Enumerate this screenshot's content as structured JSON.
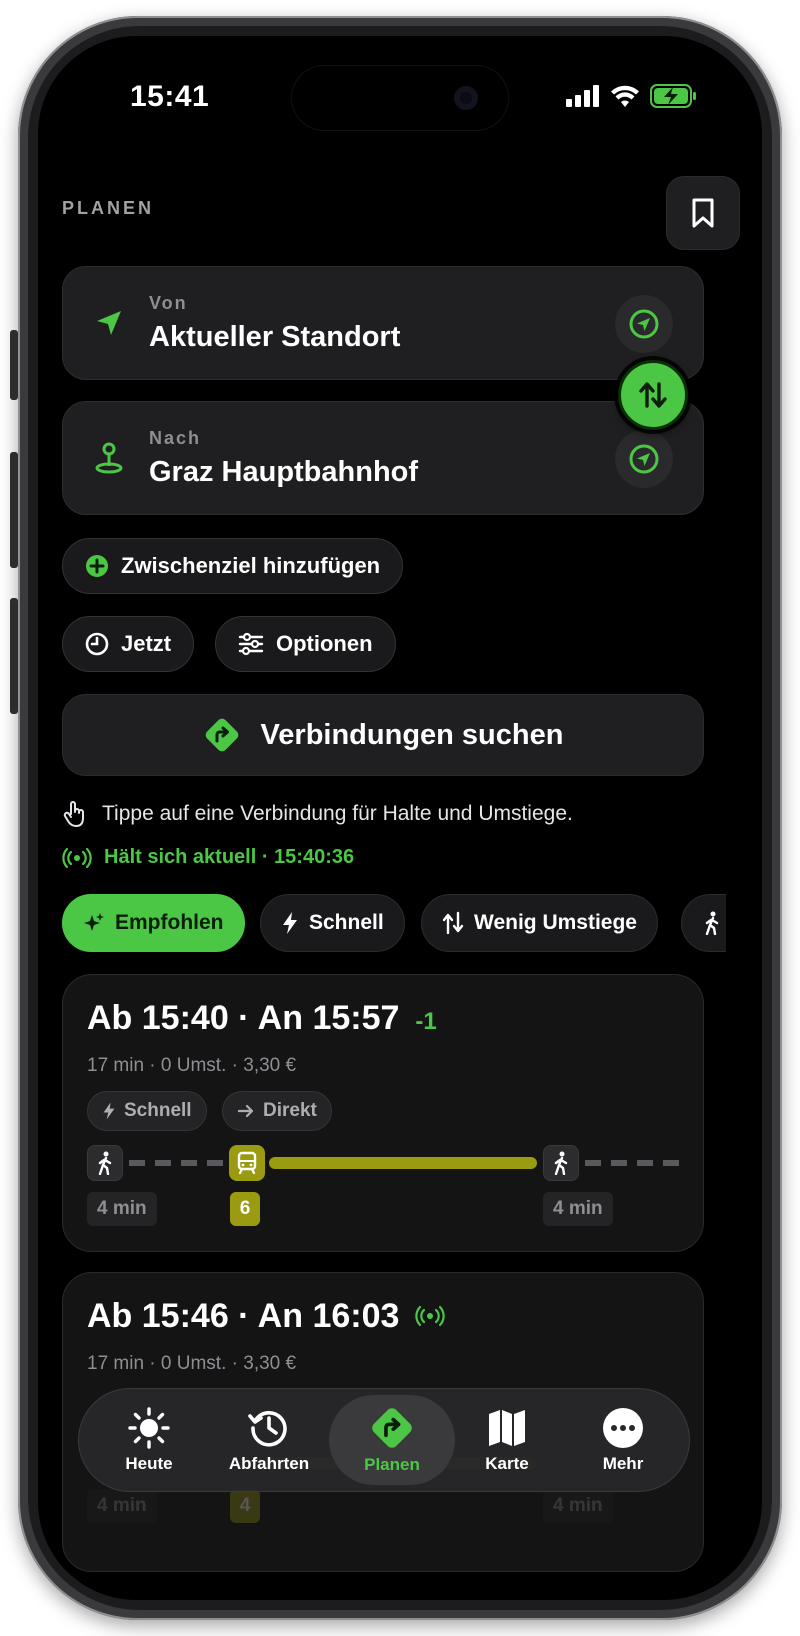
{
  "status": {
    "time": "15:41"
  },
  "header": {
    "section_label": "PLANEN"
  },
  "from": {
    "label": "Von",
    "value": "Aktueller Standort"
  },
  "to": {
    "label": "Nach",
    "value": "Graz Hauptbahnhof"
  },
  "actions": {
    "add_stop": "Zwischenziel hinzufügen",
    "time": "Jetzt",
    "options": "Optionen",
    "search": "Verbindungen suchen"
  },
  "hint": "Tippe auf eine Verbindung für Halte und Umstiege.",
  "live_status": "Hält sich aktuell · 15:40:36",
  "filters": [
    {
      "label": "Empfohlen",
      "icon": "sparkle-icon",
      "active": true
    },
    {
      "label": "Schnell",
      "icon": "bolt-icon"
    },
    {
      "label": "Wenig Umstiege",
      "icon": "transfer-icon"
    }
  ],
  "connections": [
    {
      "title": "Ab 15:40 · An 15:57",
      "delay": "-1",
      "meta": "17 min · 0 Umst. · 3,30 €",
      "tags": [
        "Schnell",
        "Direkt"
      ],
      "walk_before": "4 min",
      "line": "6",
      "walk_after": "4 min"
    },
    {
      "title": "Ab 15:46 · An 16:03",
      "meta": "17 min · 0 Umst. · 3,30 €",
      "walk_before": "4 min",
      "line": "4",
      "walk_after": "4 min"
    }
  ],
  "tabbar": [
    {
      "label": "Heute",
      "icon": "sun-icon"
    },
    {
      "label": "Abfahrten",
      "icon": "history-icon"
    },
    {
      "label": "Planen",
      "icon": "directions-icon",
      "active": true
    },
    {
      "label": "Karte",
      "icon": "map-icon"
    },
    {
      "label": "Mehr",
      "icon": "more-icon"
    }
  ],
  "colors": {
    "accent": "#4cc745",
    "tram": "#9a9b10",
    "background": "#000000",
    "card": "#1f1f21"
  }
}
